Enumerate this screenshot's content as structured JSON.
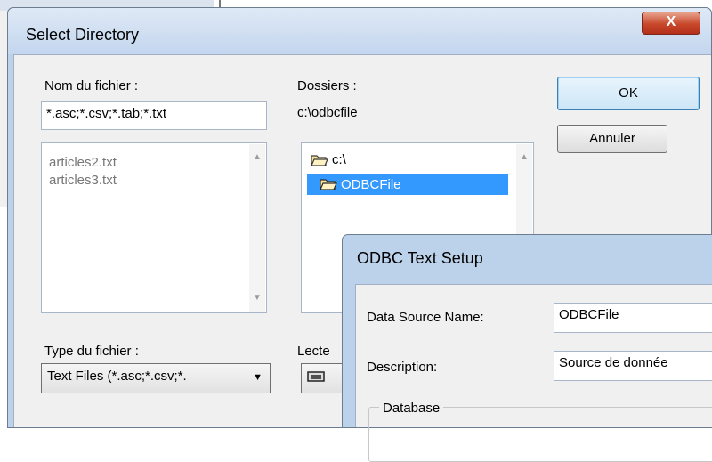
{
  "select_dialog": {
    "title": "Select Directory",
    "close_label": "X",
    "filename_label": "Nom du fichier :",
    "filename_value": "*.asc;*.csv;*.tab;*.txt",
    "files": [
      "articles2.txt",
      "articles3.txt"
    ],
    "folders_label": "Dossiers :",
    "current_path": "c:\\odbcfile",
    "folders": [
      "c:\\",
      "ODBCFile"
    ],
    "ok_label": "OK",
    "cancel_label": "Annuler",
    "filetype_label": "Type du fichier :",
    "filetype_value": "Text Files (*.asc;*.csv;*.",
    "drives_label": "Lecte"
  },
  "odbc_dialog": {
    "title": "ODBC Text Setup",
    "dsn_label": "Data Source Name:",
    "dsn_value": "ODBCFile",
    "description_label": "Description:",
    "description_value": "Source de donnée",
    "database_group_label": "Database"
  },
  "colors": {
    "selection": "#3399ff",
    "frame": "#bcd1ea",
    "close_button": "#c8472a"
  }
}
